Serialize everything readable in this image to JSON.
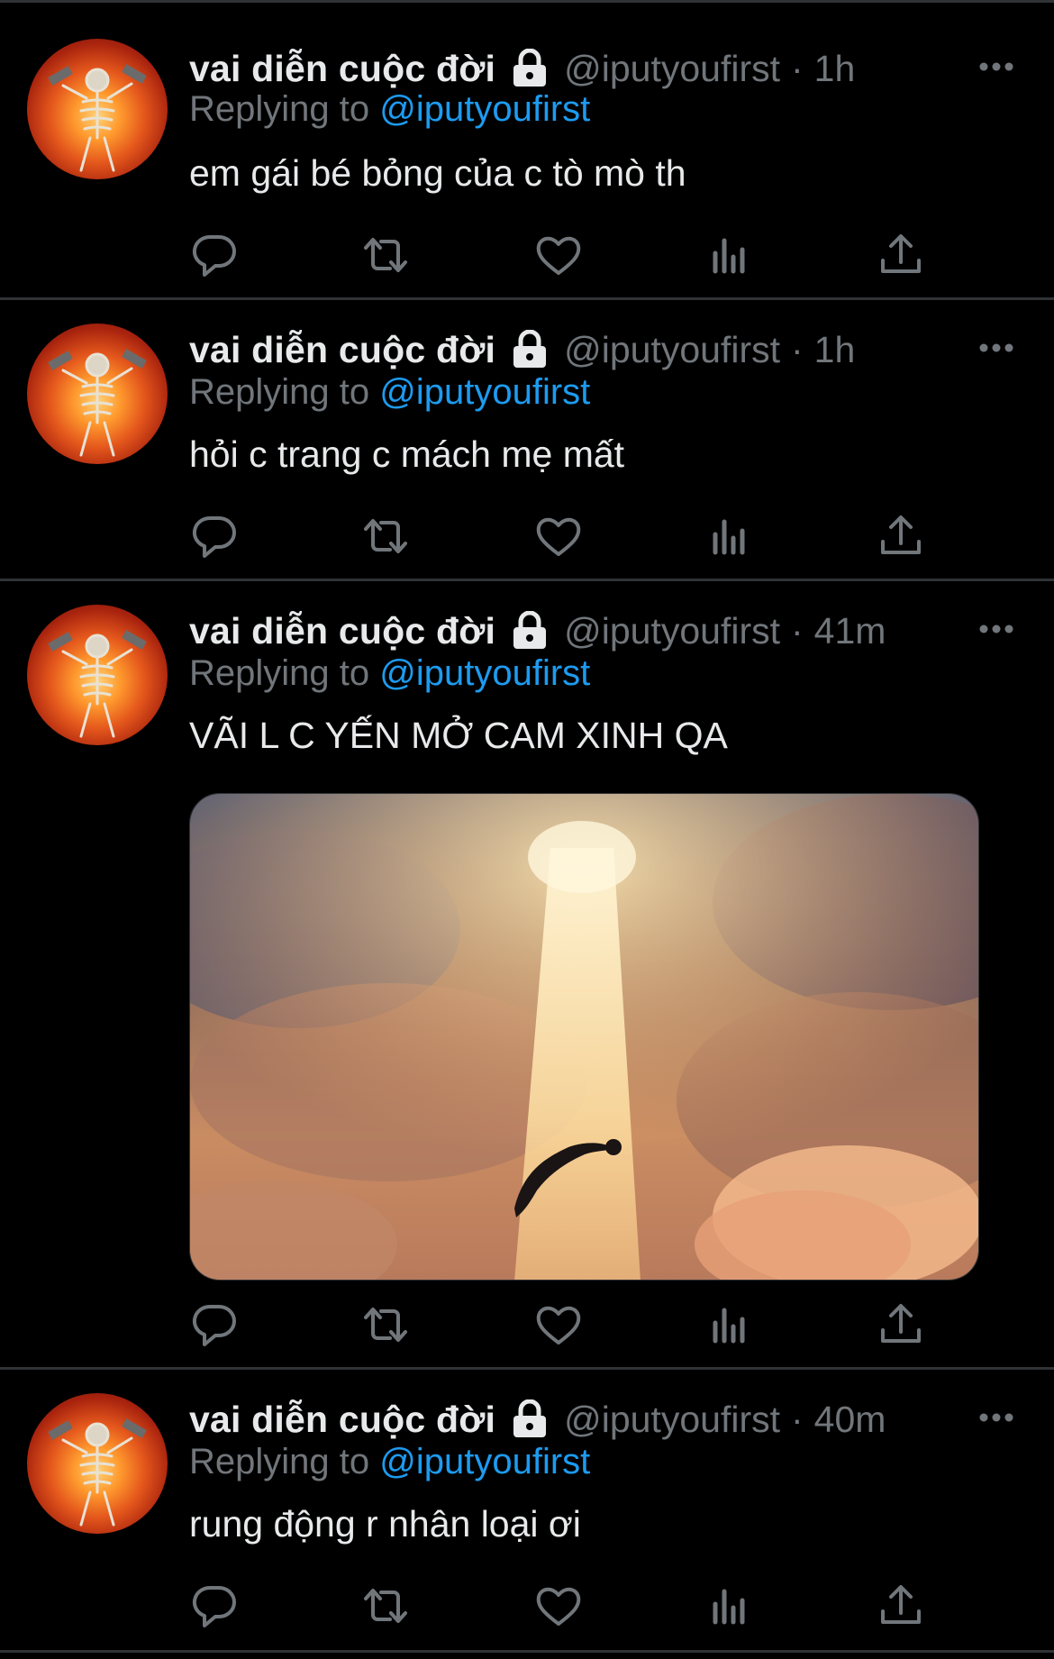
{
  "tweets": [
    {
      "name": "vai diễn cuộc đời",
      "handle": "@iputyoufirst",
      "separator": "·",
      "time": "1h",
      "replying_prefix": "Replying to",
      "replying_to": "@iputyoufirst",
      "text": "em gái bé bỏng của c tò mò th",
      "has_media": false
    },
    {
      "name": "vai diễn cuộc đời",
      "handle": "@iputyoufirst",
      "separator": "·",
      "time": "1h",
      "replying_prefix": "Replying to",
      "replying_to": "@iputyoufirst",
      "text": "hỏi c trang c mách mẹ mất",
      "has_media": false
    },
    {
      "name": "vai diễn cuộc đời",
      "handle": "@iputyoufirst",
      "separator": "·",
      "time": "41m",
      "replying_prefix": "Replying to",
      "replying_to": "@iputyoufirst",
      "text": "VÃI L C YẾN MỞ CAM XINH QA",
      "has_media": true
    },
    {
      "name": "vai diễn cuộc đời",
      "handle": "@iputyoufirst",
      "separator": "·",
      "time": "40m",
      "replying_prefix": "Replying to",
      "replying_to": "@iputyoufirst",
      "text": "rung động r nhân loại ơi",
      "has_media": false
    }
  ],
  "icons": {
    "lock": "lock-icon",
    "more": "more-icon",
    "reply": "reply-icon",
    "retweet": "retweet-icon",
    "like": "heart-icon",
    "views": "views-icon",
    "share": "share-icon"
  },
  "colors": {
    "background": "#000000",
    "primary_text": "#e7e9ea",
    "secondary_text": "#71767b",
    "link": "#1d9bf0",
    "divider": "#2f3336"
  }
}
